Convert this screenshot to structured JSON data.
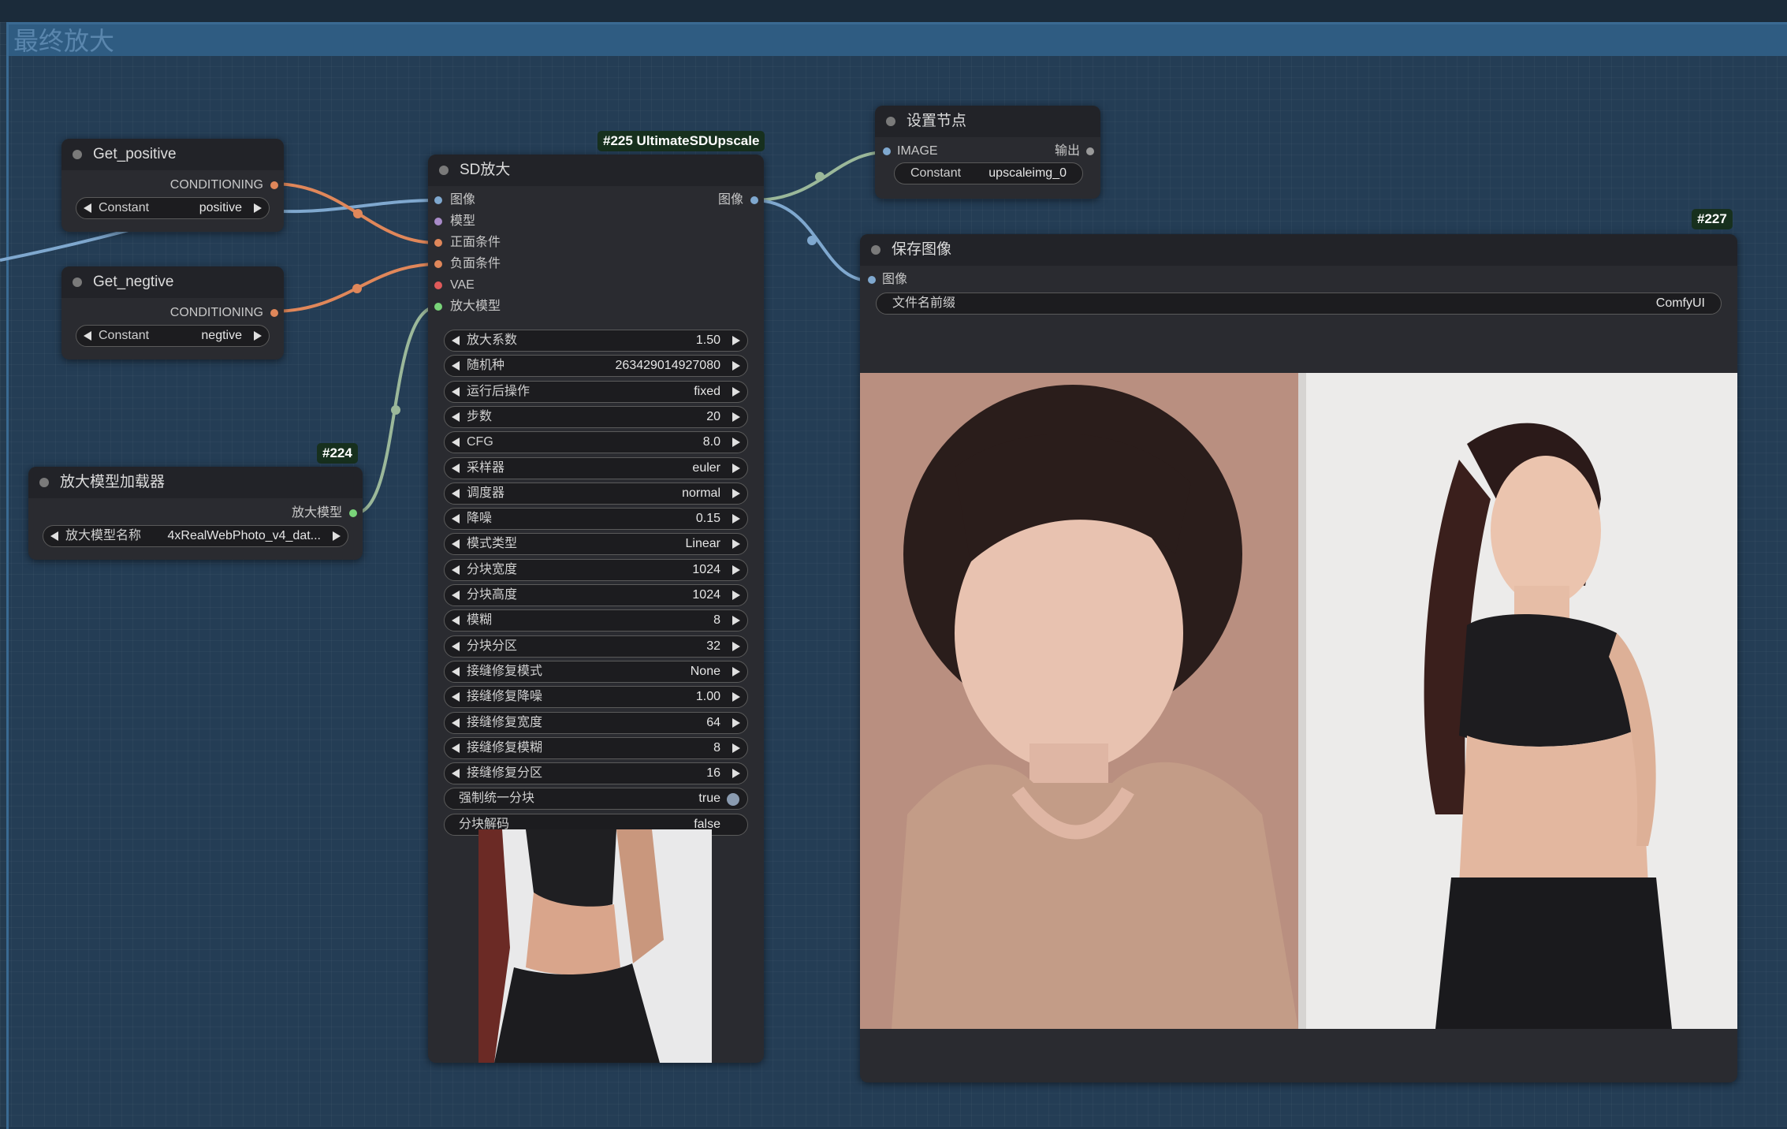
{
  "group": {
    "title": "最终放大"
  },
  "get_positive": {
    "title": "Get_positive",
    "output": "CONDITIONING",
    "widget_label": "Constant",
    "widget_value": "positive"
  },
  "get_negtive": {
    "title": "Get_negtive",
    "output": "CONDITIONING",
    "widget_label": "Constant",
    "widget_value": "negtive"
  },
  "upscale_loader": {
    "badge": "#224",
    "title": "放大模型加载器",
    "output": "放大模型",
    "widget_label": "放大模型名称",
    "widget_value": "4xRealWebPhoto_v4_dat..."
  },
  "sd_upscale": {
    "badge": "#225 UltimateSDUpscale",
    "title": "SD放大",
    "inputs": [
      "图像",
      "模型",
      "正面条件",
      "负面条件",
      "VAE",
      "放大模型"
    ],
    "output": "图像",
    "widgets": [
      {
        "label": "放大系数",
        "value": "1.50"
      },
      {
        "label": "随机种",
        "value": "263429014927080"
      },
      {
        "label": "运行后操作",
        "value": "fixed"
      },
      {
        "label": "步数",
        "value": "20"
      },
      {
        "label": "CFG",
        "value": "8.0"
      },
      {
        "label": "采样器",
        "value": "euler"
      },
      {
        "label": "调度器",
        "value": "normal"
      },
      {
        "label": "降噪",
        "value": "0.15"
      },
      {
        "label": "模式类型",
        "value": "Linear"
      },
      {
        "label": "分块宽度",
        "value": "1024"
      },
      {
        "label": "分块高度",
        "value": "1024"
      },
      {
        "label": "模糊",
        "value": "8"
      },
      {
        "label": "分块分区",
        "value": "32"
      },
      {
        "label": "接缝修复模式",
        "value": "None"
      },
      {
        "label": "接缝修复降噪",
        "value": "1.00"
      },
      {
        "label": "接缝修复宽度",
        "value": "64"
      },
      {
        "label": "接缝修复模糊",
        "value": "8"
      },
      {
        "label": "接缝修复分区",
        "value": "16"
      }
    ],
    "toggles": [
      {
        "label": "强制统一分块",
        "value": "true"
      },
      {
        "label": "分块解码",
        "value": "false"
      }
    ]
  },
  "set_node": {
    "title": "设置节点",
    "input": "IMAGE",
    "output": "输出",
    "widget_label": "Constant",
    "widget_value": "upscaleimg_0"
  },
  "save_image": {
    "badge": "#227",
    "title": "保存图像",
    "input": "图像",
    "widget_label": "文件名前缀",
    "widget_value": "ComfyUI"
  },
  "colors": {
    "conditioning": "#e0875a",
    "image": "#7fa8cf",
    "model": "#a98bc9",
    "vae": "#e05a5a",
    "upscale_model": "#79d479",
    "node_bg": "#2a2b30",
    "group_header": "#2f5c82"
  }
}
